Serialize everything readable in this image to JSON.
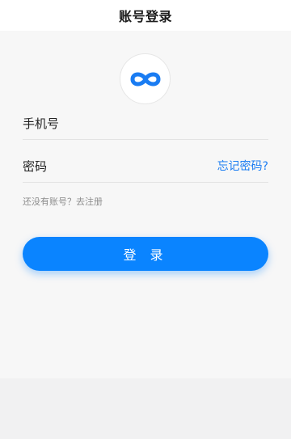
{
  "header": {
    "title": "账号登录"
  },
  "logo": {
    "icon": "infinity-icon",
    "color": "#1a7cf2"
  },
  "form": {
    "phone_label": "手机号",
    "password_label": "密码",
    "forgot_password": "忘记密码?",
    "register_prompt": "还没有账号？去注册",
    "login_button": "登 录"
  },
  "colors": {
    "accent": "#0a84ff",
    "link": "#1a7cf2"
  }
}
